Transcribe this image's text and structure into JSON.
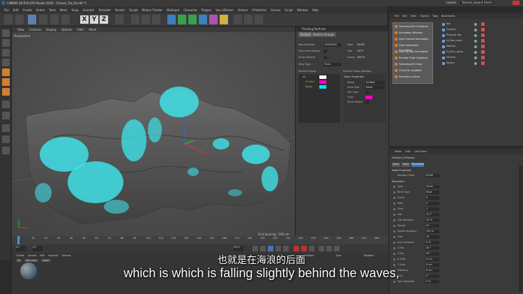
{
  "window": {
    "title": "CINEMA 4D R16.050 Studio (R16) - [Ocean_Tut_04.c4d *]",
    "layout_label": "Layout:",
    "layout_value": "Tutorial_Layout (User)"
  },
  "menu": [
    "File",
    "Edit",
    "Create",
    "Select",
    "Tools",
    "Mesh",
    "Snap",
    "Animate",
    "Simulate",
    "Render",
    "Sculpt",
    "Motion Tracker",
    "MoGraph",
    "Character",
    "Plugins",
    "Vue xStream",
    "Octane",
    "X-Particles",
    "Corona",
    "Script",
    "Window",
    "Help"
  ],
  "toolbar": {
    "x_label": "X",
    "y_label": "Y",
    "z_label": "Z"
  },
  "viewport": {
    "menu": [
      "View",
      "Cameras",
      "Display",
      "Options",
      "Filter",
      "Panel"
    ],
    "label": "Perspective",
    "grid_spacing": "Grid Spacing : 100 cm"
  },
  "thinking_panel": {
    "header": "Thinking Particles",
    "tabs": [
      "Particle",
      "Particle Groups"
    ],
    "max_particles_label": "Max Particles",
    "max_particles_value": "10000000",
    "total_label": "Total",
    "total_value": "28435",
    "force_mode_label": "Force this Setting",
    "tree_label": "Tree",
    "tree_value": "2875",
    "show_objects_label": "Show Objects",
    "group_label": "Group",
    "group_value": "28475",
    "view_type_label": "View Type",
    "view_type_value": "Ticks",
    "particle_group_label": "Particle Group",
    "groups": [
      "All",
      "Emitter",
      "Spray"
    ],
    "group_colors": [
      "#ffffff",
      "#ff00c8",
      "#00e5ff"
    ],
    "settings_label": "Particle Group Settings",
    "basic_props": "Basic Properties",
    "name_label": "Name",
    "name_value": "Emitter",
    "vt_label": "View Type",
    "vt_value": "None",
    "use_color_label": "Use Color",
    "color_label": "Color",
    "show_object_label": "Show Object"
  },
  "popup_menu": [
    "TurbulenceFD Container",
    "Simulation Window",
    "Start Cached Simulation",
    "Start Interactive Simulation",
    "Start Up-Res Simulation",
    "Preview Fluid Container",
    "TurbulenceFD Help",
    "Check for Updates",
    "Purchase License"
  ],
  "object_manager": {
    "menu": [
      "File",
      "Edit",
      "View",
      "Objects",
      "Tags",
      "Bookmarks"
    ],
    "objects": [
      "Sky",
      "Camera",
      "Physical Sky",
      "Hi_Res_mesh",
      "WalSep",
      "Hi_Res_Lights",
      "Vertical",
      "Motion"
    ]
  },
  "attribute_manager": {
    "menu": [
      "Mode",
      "Edit",
      "User Data"
    ],
    "object_name": "xFlowns [xFlowns]",
    "tabs": [
      "Basic",
      "Node",
      "Parameter"
    ],
    "section1": "Node Properties",
    "random_seed_label": "Random Seed",
    "random_seed_value": "12345",
    "section2": "Parameter",
    "params": [
      {
        "label": "Type",
        "value": "Circle"
      },
      {
        "label": "Birth Type",
        "value": "Shot"
      },
      {
        "label": "Count",
        "value": "0"
      },
      {
        "label": "Rate",
        "value": "0"
      },
      {
        "label": "Shot",
        "value": "1"
      },
      {
        "label": "Life",
        "value": "10 F"
      },
      {
        "label": "Life Variation",
        "value": "10 %"
      },
      {
        "label": "Speed",
        "value": "20"
      },
      {
        "label": "Speed Variation",
        "value": "100 %"
      },
      {
        "label": "Size",
        "value": "10"
      },
      {
        "label": "Size Variation",
        "value": "0 %"
      },
      {
        "label": "X Pos",
        "value": "45 °"
      },
      {
        "label": "Y Pos",
        "value": "45 °"
      },
      {
        "label": "X Side",
        "value": "0 cm"
      },
      {
        "label": "Y Side",
        "value": "0 cm"
      },
      {
        "label": "Distance",
        "value": "0 cm"
      },
      {
        "label": "Spin",
        "value": "0 °"
      },
      {
        "label": "Spin Variation",
        "value": "0 %"
      }
    ]
  },
  "timeline": {
    "ticks": [
      "0",
      "10",
      "20",
      "30",
      "40",
      "50",
      "60",
      "70",
      "80",
      "90",
      "100",
      "110",
      "120",
      "130",
      "140",
      "150",
      "160",
      "170",
      "180",
      "190",
      "200",
      "210",
      "220",
      "230",
      "240",
      "250",
      "260",
      "270",
      "280"
    ],
    "current_frame": "0 F",
    "start": "0 F",
    "end": "250 F"
  },
  "material_manager": {
    "menu": [
      "Create",
      "Corona",
      "Edit",
      "Function",
      "Texture"
    ],
    "tabs": [
      "All",
      "No Layer",
      "Layer"
    ]
  },
  "coords": {
    "position": "Position",
    "size": "Size",
    "rotation": "Rotation"
  },
  "subtitle": {
    "zh": "也就是在海浪的后面",
    "en": "which is which is falling slightly behind the waves,"
  },
  "colors": {
    "particles": "#3fe0e6",
    "terrain": "#5b5b5b",
    "magenta": "#ff00c8"
  }
}
